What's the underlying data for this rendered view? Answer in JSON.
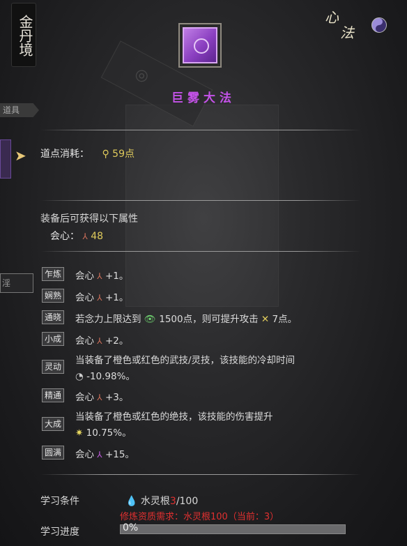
{
  "header": {
    "realm": "金丹境",
    "xinfa_1": "心",
    "xinfa_2": "法",
    "skill_title": "巨雾大法"
  },
  "side": {
    "tab_label": "道具",
    "box_label": "淫"
  },
  "cost": {
    "label": "道点消耗：",
    "value": "59点"
  },
  "attributes": {
    "heading": "装备后可获得以下属性",
    "stat_label": "会心：",
    "stat_value": "48"
  },
  "levels": [
    {
      "tag": "乍炼",
      "text": "会心",
      "extra": "+1。"
    },
    {
      "tag": "娴熟",
      "text": "会心",
      "extra": "+1。"
    },
    {
      "tag": "通晓",
      "text": "若念力上限达到",
      "v1": "1500点，则可提升攻击",
      "v2": "7点。"
    },
    {
      "tag": "小成",
      "text": "会心",
      "extra": "+2。"
    },
    {
      "tag": "灵动",
      "text": "当装备了橙色或红色的武技/灵技，该技能的冷却时间",
      "text2": "-10.98%。"
    },
    {
      "tag": "精通",
      "text": "会心",
      "extra": "+3。"
    },
    {
      "tag": "大成",
      "text": "当装备了橙色或红色的绝技，该技能的伤害提升",
      "text2": "10.75%。"
    },
    {
      "tag": "圆满",
      "text": "会心",
      "extra": "+15。"
    }
  ],
  "requirement": {
    "label": "学习条件",
    "item": "水灵根",
    "have": "3",
    "need": "/100",
    "warning": "修炼资质需求：水灵根100（当前：3）"
  },
  "progress": {
    "label": "学习进度",
    "value_text": "0%",
    "fraction": 0
  },
  "colors": {
    "title": "#c452e8",
    "yellow": "#e0cb5c",
    "red": "#e03030"
  }
}
